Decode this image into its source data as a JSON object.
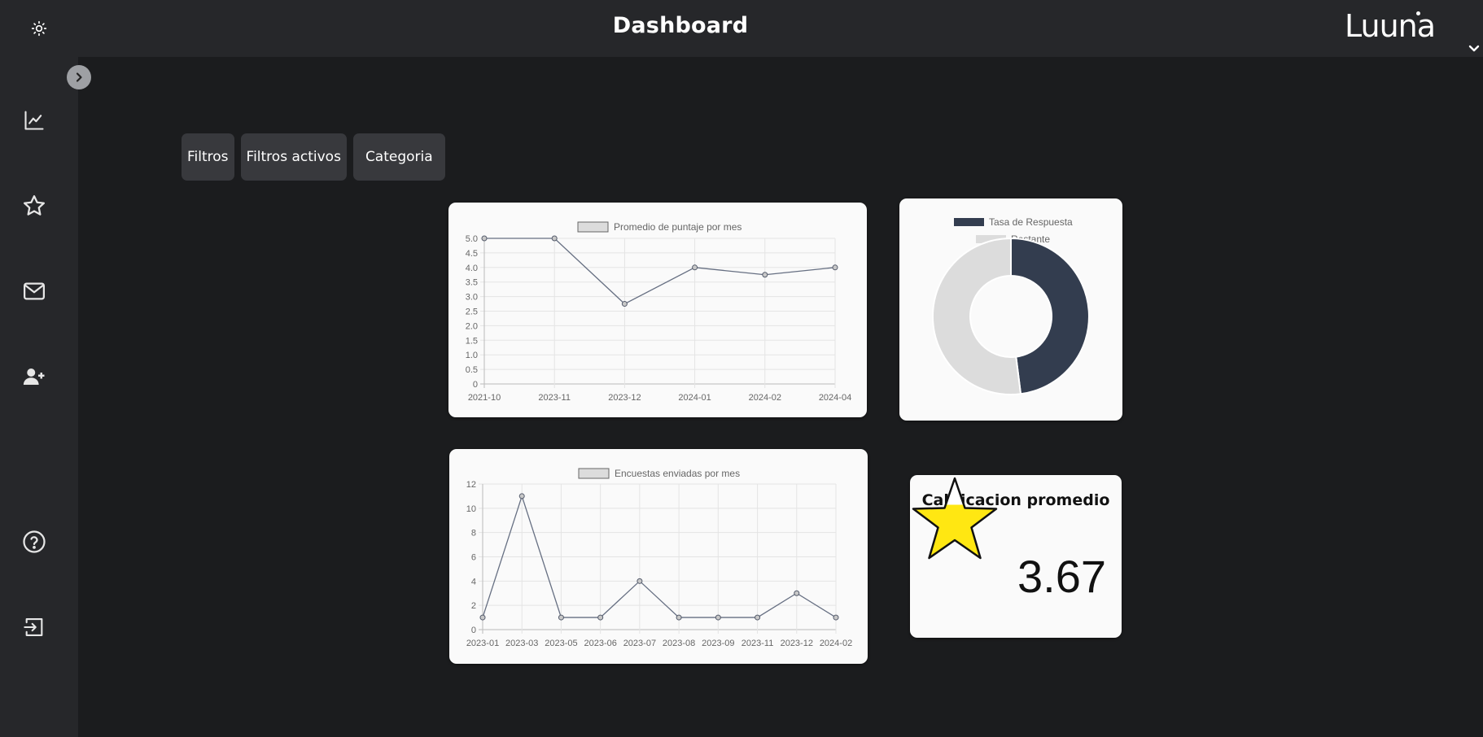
{
  "header": {
    "title": "Dashboard",
    "logo_text": "Luuna"
  },
  "icons": {
    "theme": "sun-icon",
    "sidebar": [
      "chart-line-icon",
      "star-icon",
      "mail-icon",
      "user-plus-icon",
      "help-circle-icon",
      "logout-icon"
    ],
    "collapse": "chevron-right-icon",
    "menu": "chevron-down-icon"
  },
  "filters": {
    "filtros": "Filtros",
    "activos": "Filtros activos",
    "categoria": "Categoria"
  },
  "colors": {
    "accent_dark": "#333d4f",
    "light_gray": "#dcdcdc",
    "star_fill": "#ffe712"
  },
  "charts": {
    "score": {
      "type": "line",
      "legend": "Promedio de puntaje por mes",
      "x": [
        "2021-10",
        "2023-11",
        "2023-12",
        "2024-01",
        "2024-02",
        "2024-04"
      ],
      "values": [
        5.0,
        5.0,
        2.75,
        4.0,
        3.75,
        4.0
      ],
      "ylim": [
        0,
        5
      ],
      "yticks": [
        "5.0",
        "4.5",
        "4.0",
        "3.5",
        "3.0",
        "2.5",
        "2.0",
        "1.5",
        "1.0",
        "0.5",
        "0"
      ],
      "grid": true
    },
    "response": {
      "type": "pie",
      "legend": [
        "Tasa de Respuesta",
        "Restante"
      ],
      "values": [
        48,
        52
      ]
    },
    "surveys": {
      "type": "line",
      "legend": "Encuestas enviadas por mes",
      "x": [
        "2023-01",
        "2023-03",
        "2023-05",
        "2023-06",
        "2023-07",
        "2023-08",
        "2023-09",
        "2023-11",
        "2023-12",
        "2024-02"
      ],
      "values": [
        1,
        11,
        1,
        1,
        4,
        1,
        1,
        1,
        3,
        1
      ],
      "ylim": [
        0,
        12
      ],
      "yticks": [
        "12",
        "10",
        "8",
        "6",
        "4",
        "2",
        "0"
      ],
      "grid": true
    }
  },
  "chart_data": [
    {
      "type": "line",
      "legend": "Promedio de puntaje por mes",
      "x": [
        "2021-10",
        "2023-11",
        "2023-12",
        "2024-01",
        "2024-02",
        "2024-04"
      ],
      "values": [
        5.0,
        5.0,
        2.75,
        4.0,
        3.75,
        4.0
      ],
      "ylim": [
        0,
        5
      ],
      "grid": true
    },
    {
      "type": "pie",
      "labels": [
        "Tasa de Respuesta",
        "Restante"
      ],
      "values": [
        48,
        52
      ],
      "legend_position": "top"
    },
    {
      "type": "line",
      "legend": "Encuestas enviadas por mes",
      "x": [
        "2023-01",
        "2023-03",
        "2023-05",
        "2023-06",
        "2023-07",
        "2023-08",
        "2023-09",
        "2023-11",
        "2023-12",
        "2024-02"
      ],
      "values": [
        1,
        11,
        1,
        1,
        4,
        1,
        1,
        1,
        3,
        1
      ],
      "ylim": [
        0,
        12
      ],
      "grid": true
    }
  ],
  "rating": {
    "title": "Calificacion promedio",
    "value": "3.67",
    "fill_fraction": 0.67
  }
}
